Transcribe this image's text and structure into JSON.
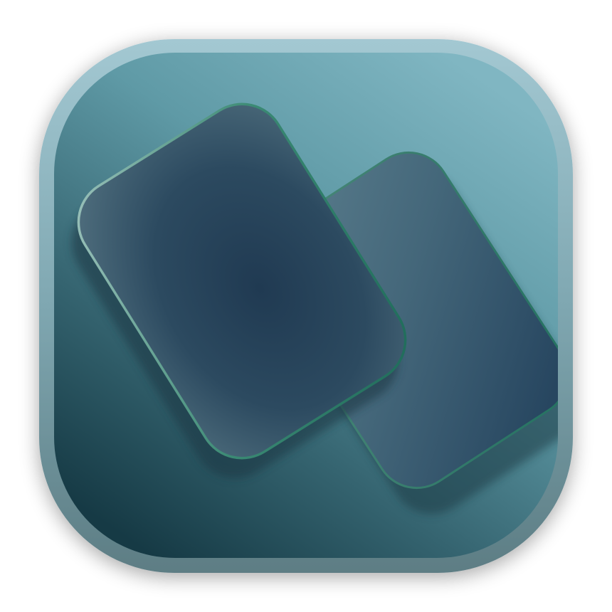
{
  "icon": {
    "name": "app-icon-stacked-cards",
    "description_shapes": [
      "rounded-square-tile",
      "back-card",
      "front-card"
    ]
  },
  "colors": {
    "page_background": "#ffffff",
    "tile_frame_top": "#9ec4cf",
    "tile_frame_bottom": "#5f7f86",
    "tile_fill_top": "#7cb1be",
    "tile_fill_mid": "#4c8791",
    "tile_fill_bottom": "#173c48",
    "card_dark": "#223e55",
    "card_light": "#4f7485",
    "card_edge_green": "#2f7d6a",
    "card_edge_highlight": "#8fb8b4",
    "card_shadow": "#1f3d48"
  }
}
